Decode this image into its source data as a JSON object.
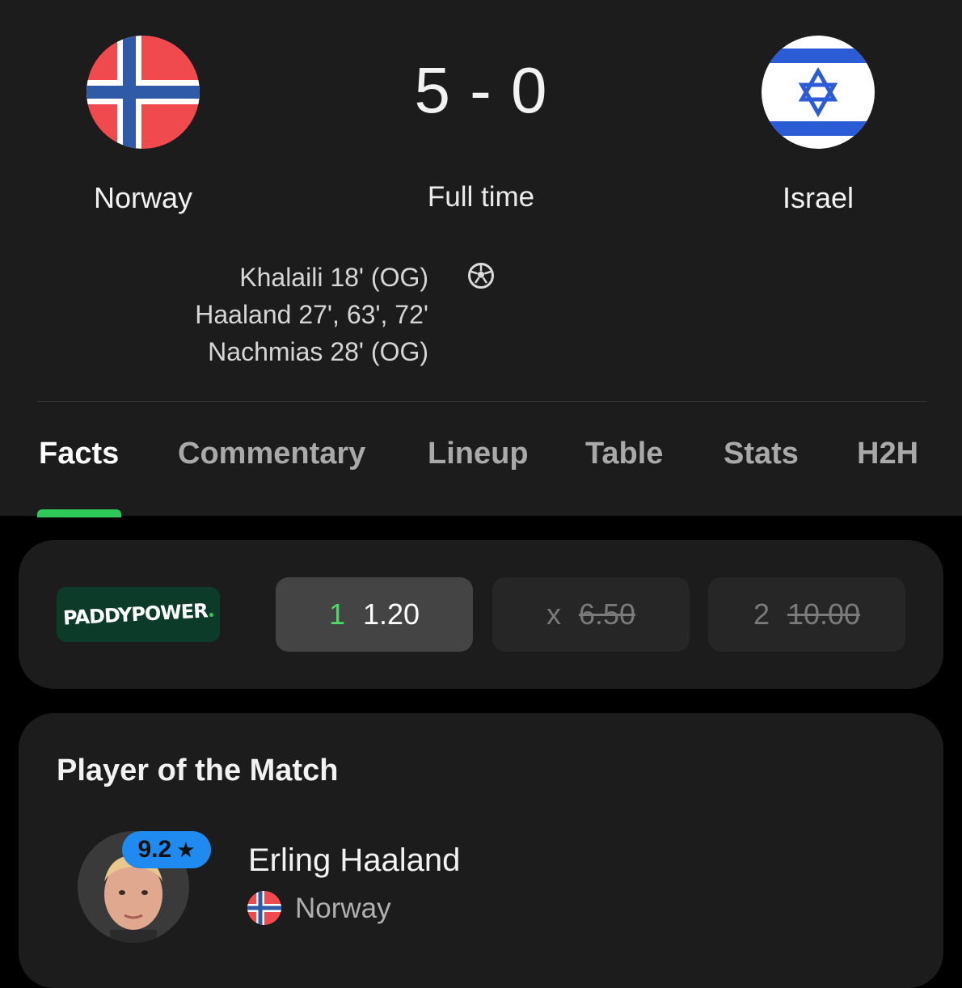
{
  "match": {
    "home_team": "Norway",
    "away_team": "Israel",
    "score": "5 - 0",
    "status": "Full time",
    "home_scorers": [
      "Khalaili 18' (OG)",
      "Haaland 27', 63', 72'",
      "Nachmias 28' (OG)"
    ],
    "icons": {
      "home_flag": "norway-flag-icon",
      "away_flag": "israel-flag-icon",
      "goal": "soccer-ball-icon"
    }
  },
  "tabs": [
    {
      "label": "Facts",
      "active": true
    },
    {
      "label": "Commentary",
      "active": false
    },
    {
      "label": "Lineup",
      "active": false
    },
    {
      "label": "Table",
      "active": false
    },
    {
      "label": "Stats",
      "active": false
    },
    {
      "label": "H2H",
      "active": false
    }
  ],
  "odds": {
    "bookmaker": "PADDYPOWER",
    "home": {
      "label": "1",
      "value": "1.20"
    },
    "draw": {
      "label": "x",
      "value": "6.50"
    },
    "away": {
      "label": "2",
      "value": "10.00"
    }
  },
  "player_of_match": {
    "title": "Player of the Match",
    "name": "Erling Haaland",
    "team": "Norway",
    "rating": "9.2",
    "rating_icon": "star-icon"
  },
  "colors": {
    "accent_green": "#2fc95a",
    "rating_blue": "#1f8bf0",
    "card_bg": "#1c1c1c",
    "page_bg": "#000000"
  }
}
